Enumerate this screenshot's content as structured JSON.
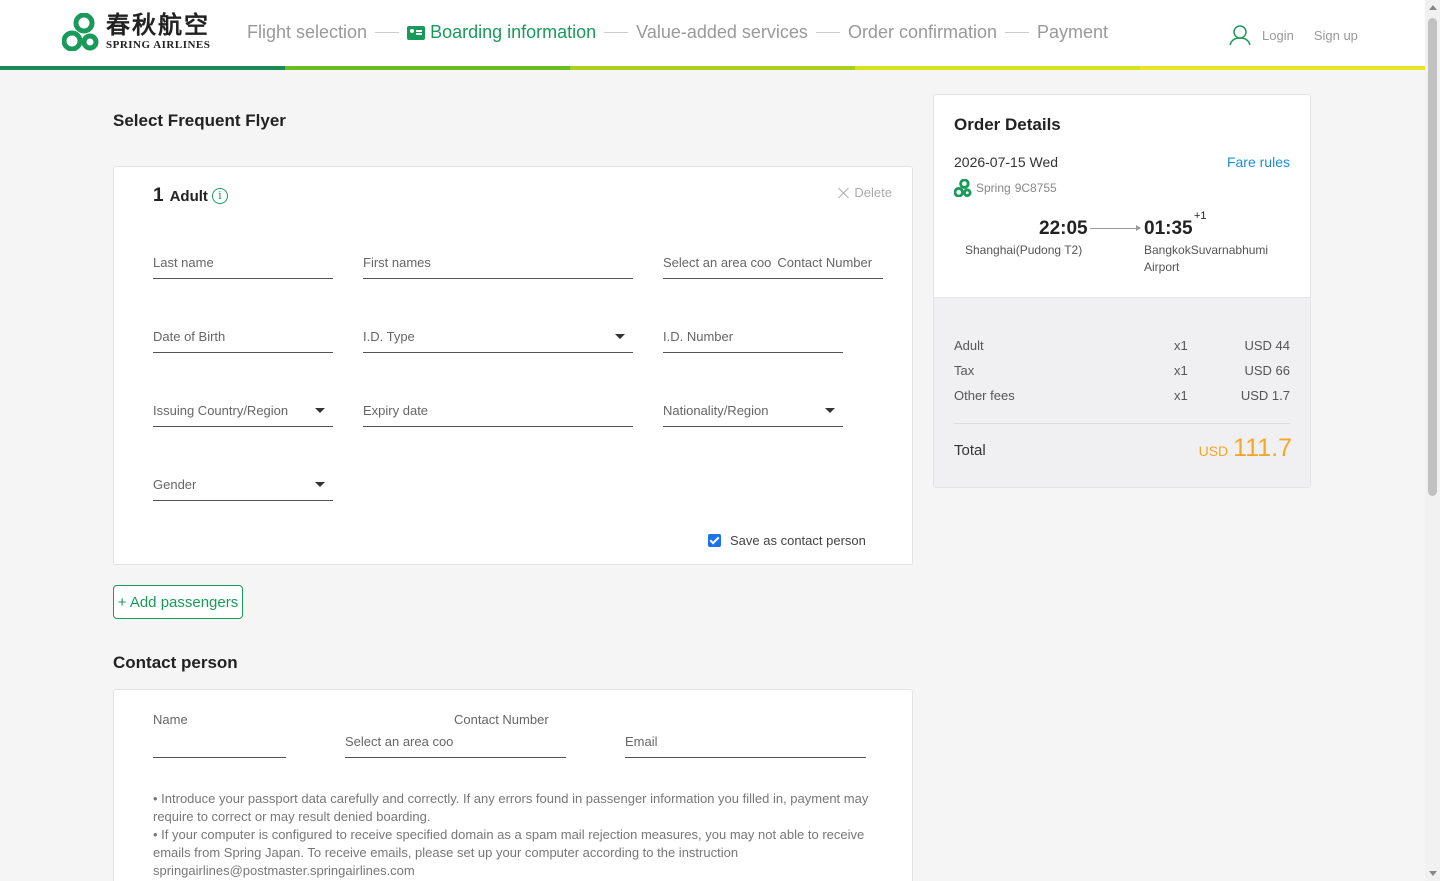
{
  "brand": {
    "name_cn": "春秋航空",
    "name_en": "SPRING AIRLINES",
    "green": "#1a9a5a"
  },
  "steps": [
    {
      "label": "Flight selection",
      "active": false
    },
    {
      "label": "Boarding information",
      "active": true
    },
    {
      "label": "Value-added services",
      "active": false
    },
    {
      "label": "Order confirmation",
      "active": false
    },
    {
      "label": "Payment",
      "active": false
    }
  ],
  "auth": {
    "login": "Login",
    "signup": "Sign up"
  },
  "frequent_flyer": {
    "title": "Select Frequent Flyer",
    "passenger_number": "1",
    "passenger_type": "Adult",
    "delete_label": "Delete",
    "fields": {
      "last_name": "Last name",
      "first_names": "First names",
      "area_code": "Select an area coo",
      "contact_number": "Contact Number",
      "date_of_birth": "Date of Birth",
      "id_type": "I.D. Type",
      "id_number": "I.D. Number",
      "issuing_country": "Issuing Country/Region",
      "expiry_date": "Expiry date",
      "nationality": "Nationality/Region",
      "gender": "Gender"
    },
    "save_contact_label": "Save as contact person",
    "save_contact_checked": true
  },
  "add_passengers_label": "+ Add passengers",
  "contact": {
    "title": "Contact person",
    "name_label": "Name",
    "contact_number_label": "Contact Number",
    "area_code": "Select an area coo",
    "email": "Email",
    "notes": [
      "• Introduce your passport data carefully and correctly. If any errors found in passenger information you filled in, payment may require to correct or may result denied boarding.",
      "• If your computer is configured to receive specified domain as a spam mail rejection measures, you may not able to receive emails from Spring Japan. To receive emails, please set up your computer according to the instruction",
      "springairlines@postmaster.springairlines.com"
    ]
  },
  "order": {
    "title": "Order Details",
    "date": "2026-07-15 Wed",
    "fare_rules": "Fare rules",
    "airline": "Spring",
    "flight_no": "9C8755",
    "depart_time": "22:05",
    "arrive_time": "01:35",
    "plus_day": "+1",
    "depart_city": "Shanghai(Pudong T2)",
    "arrive_city_1": "BangkokSuvarnabhumi",
    "arrive_city_2": "Airport",
    "fees": [
      {
        "label": "Adult",
        "qty": "x1",
        "amount": "USD 44"
      },
      {
        "label": "Tax",
        "qty": "x1",
        "amount": "USD 66"
      },
      {
        "label": "Other fees",
        "qty": "x1",
        "amount": "USD 1.7"
      }
    ],
    "total_label": "Total",
    "total_currency": "USD",
    "total_amount": "111.7",
    "total_color": "#f5a623"
  }
}
